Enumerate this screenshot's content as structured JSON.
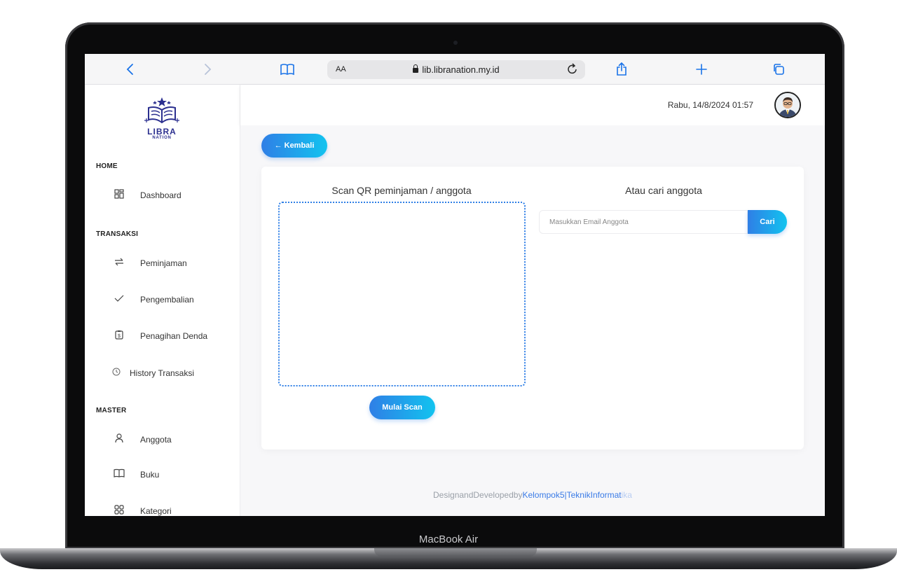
{
  "device": {
    "label": "MacBook Air"
  },
  "browser": {
    "aa_label": "AA",
    "url": "lib.libranation.my.id"
  },
  "logo": {
    "line1": "LIBRA",
    "line2": "NATION"
  },
  "sidebar": {
    "sections": [
      {
        "title": "HOME",
        "items": [
          {
            "label": "Dashboard",
            "icon": "dashboard-icon"
          }
        ]
      },
      {
        "title": "TRANSAKSI",
        "items": [
          {
            "label": "Peminjaman",
            "icon": "swap-icon"
          },
          {
            "label": "Pengembalian",
            "icon": "check-icon"
          },
          {
            "label": "Penagihan Denda",
            "icon": "receipt-icon"
          },
          {
            "label": "History Transaksi",
            "icon": "clock-icon"
          }
        ]
      },
      {
        "title": "MASTER",
        "items": [
          {
            "label": "Anggota",
            "icon": "user-icon"
          },
          {
            "label": "Buku",
            "icon": "book-icon"
          },
          {
            "label": "Kategori",
            "icon": "category-icon"
          }
        ]
      }
    ]
  },
  "header": {
    "datetime": "Rabu, 14/8/2024 01:57"
  },
  "main": {
    "back_label": "← Kembali",
    "scan_title": "Scan QR peminjaman / anggota",
    "scan_button": "Mulai Scan",
    "search_title": "Atau cari anggota",
    "search_placeholder": "Masukkan Email Anggota",
    "search_button": "Cari"
  },
  "footer": {
    "prefix": "DesignandDevelopedby",
    "highlight": "Kelompok5|TeknikInformat",
    "faded": "ika"
  },
  "colors": {
    "accent_start": "#2f7fe6",
    "accent_end": "#12c3ef",
    "logo": "#2b2f8f"
  }
}
